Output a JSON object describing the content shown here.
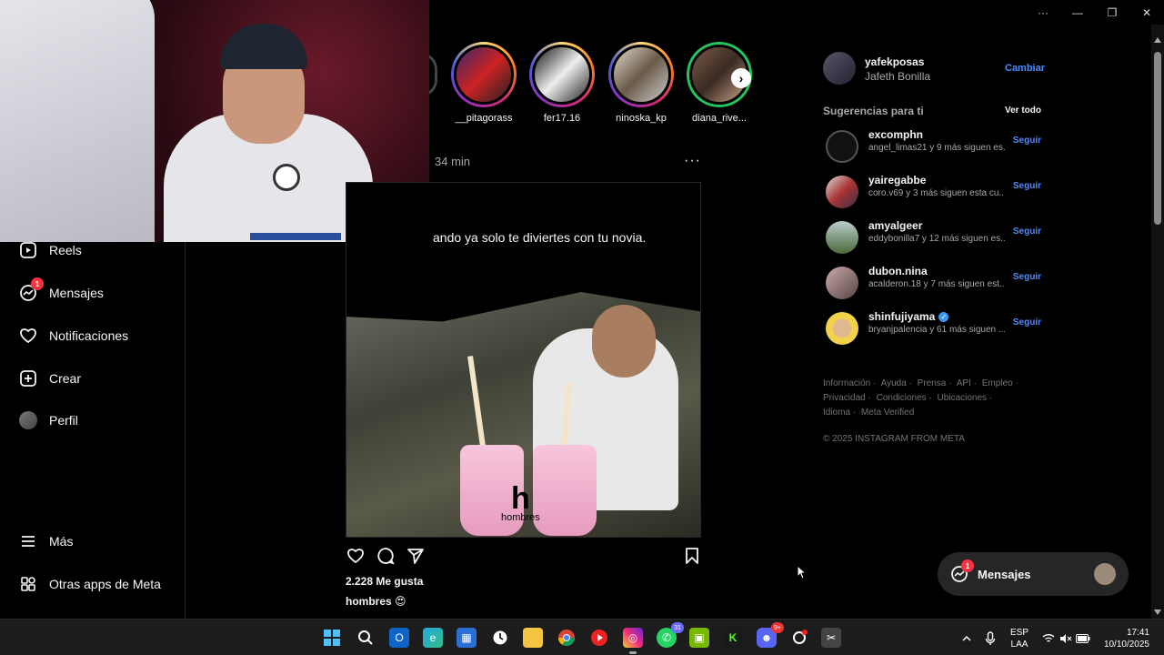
{
  "window": {
    "controls": [
      "···",
      "—",
      "❐",
      "✕"
    ]
  },
  "sidebar": {
    "items": [
      {
        "label": "Reels",
        "icon": "reels-icon"
      },
      {
        "label": "Mensajes",
        "icon": "messenger-icon",
        "badge": "1"
      },
      {
        "label": "Notificaciones",
        "icon": "heart-icon"
      },
      {
        "label": "Crear",
        "icon": "plus-square-icon"
      },
      {
        "label": "Perfil",
        "icon": "avatar"
      }
    ],
    "bottom": [
      {
        "label": "Más",
        "icon": "hamburger-icon"
      },
      {
        "label": "Otras apps de Meta",
        "icon": "meta-apps-icon"
      }
    ]
  },
  "stories": [
    {
      "name": "__pitagorass"
    },
    {
      "name": "fer17.16"
    },
    {
      "name": "ninoska_kp"
    },
    {
      "name": "diana_rive..."
    }
  ],
  "post": {
    "time": "34 min",
    "more": "···",
    "caption_top": "ando ya solo te diviertes con tu novia.",
    "watermark_big": "h",
    "watermark_small": "hombres",
    "likes": "2.228 Me gusta",
    "caption_user": "hombres 😍"
  },
  "account": {
    "username": "yafekposas",
    "fullname": "Jafeth Bonilla",
    "switch_label": "Cambiar"
  },
  "suggestions": {
    "heading": "Sugerencias para ti",
    "see_all": "Ver todo",
    "follow_label": "Seguir",
    "items": [
      {
        "user": "excomphn",
        "sub": "angel_limas21 y 9 más siguen es...",
        "verified": false
      },
      {
        "user": "yairegabbe",
        "sub": "coro.v69 y 3 más siguen esta cu...",
        "verified": false
      },
      {
        "user": "amyalgeer",
        "sub": "eddybonilla7 y 12 más siguen es...",
        "verified": false
      },
      {
        "user": "dubon.nina",
        "sub": "acalderon.18 y 7 más siguen est...",
        "verified": false
      },
      {
        "user": "shinfujiyama",
        "sub": "bryanjpalencia y 61 más siguen ...",
        "verified": true
      }
    ]
  },
  "footer": {
    "links": [
      "Información ·",
      "Ayuda ·",
      "Prensa ·",
      "API ·",
      "Empleo ·",
      "Privacidad ·",
      "Condiciones ·",
      "Ubicaciones ·",
      "Idioma ·",
      "Meta Verified"
    ],
    "copyright": "© 2025 INSTAGRAM FROM META"
  },
  "messages_pill": {
    "label": "Mensajes",
    "badge": "1"
  },
  "taskbar": {
    "whatsapp_badge": "31",
    "discord_badge": "9+",
    "lang_top": "ESP",
    "lang_bottom": "LAA",
    "time": "17:41",
    "date": "10/10/2025"
  },
  "colors": {
    "accent_blue": "#4a8cff",
    "notification_red": "#ff3040",
    "background": "#000000"
  }
}
